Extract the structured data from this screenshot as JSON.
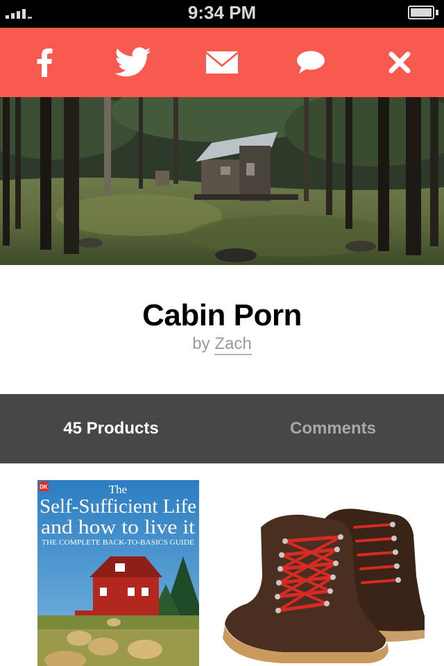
{
  "status_bar": {
    "time": "9:34 PM"
  },
  "share_bar": {
    "background": "#f85a50",
    "buttons": [
      {
        "icon": "facebook-icon"
      },
      {
        "icon": "twitter-icon"
      },
      {
        "icon": "mail-icon"
      },
      {
        "icon": "comment-icon"
      },
      {
        "icon": "close-icon"
      }
    ]
  },
  "collection": {
    "title": "Cabin Porn",
    "by_prefix": "by",
    "author": "Zach"
  },
  "tabs": {
    "products_label": "45 Products",
    "comments_label": "Comments"
  },
  "products": [
    {
      "kind": "book",
      "publisher_mark": "DK",
      "title_line1": "The",
      "title_line2": "Self-Sufficient Life",
      "title_line3": "and how to live it",
      "subtitle": "THE COMPLETE BACK-TO-BASICS GUIDE"
    },
    {
      "kind": "boots"
    }
  ]
}
